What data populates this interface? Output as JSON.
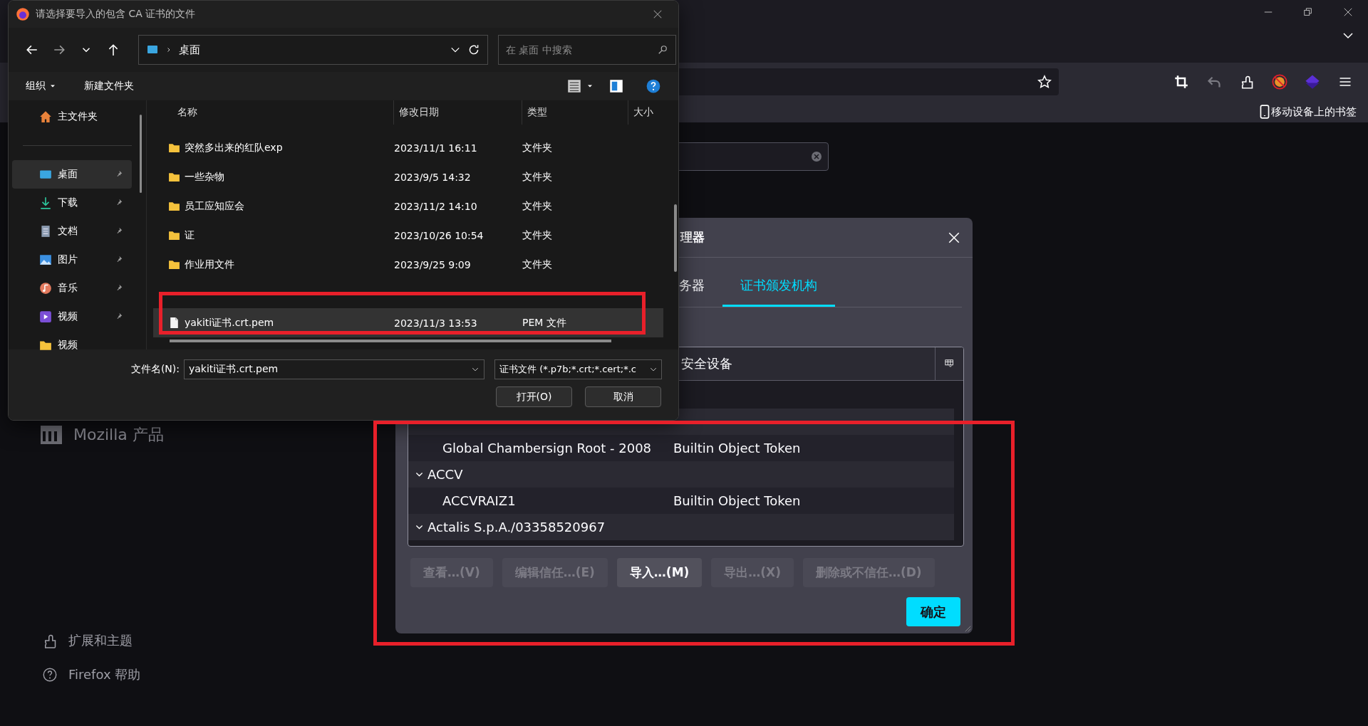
{
  "browser": {
    "bookmarks_bar": {
      "item": "移动设备上的书签"
    },
    "content_links": [
      {
        "kind": "mozilla",
        "label": "Mozilla 产品"
      },
      {
        "kind": "extensions",
        "label": "扩展和主题"
      },
      {
        "kind": "help",
        "label": "Firefox 帮助"
      }
    ]
  },
  "cert_manager": {
    "title": "理器",
    "tabs": [
      {
        "label": "务器",
        "selected": false
      },
      {
        "label": "证书颁发机构",
        "selected": true
      }
    ],
    "columns": [
      "安全设备"
    ],
    "rows": [
      {
        "kind": "obscured"
      },
      {
        "kind": "leaf",
        "name": "Global Chambersign Root - 2008",
        "device": "Builtin Object Token"
      },
      {
        "kind": "group",
        "name": "ACCV",
        "expanded": true
      },
      {
        "kind": "leaf",
        "name": "ACCVRAIZ1",
        "device": "Builtin Object Token"
      },
      {
        "kind": "group",
        "name": "Actalis S.p.A./03358520967",
        "expanded": true
      }
    ],
    "buttons": [
      {
        "label": "查看…(V)",
        "disabled": true
      },
      {
        "label": "编辑信任…(E)",
        "disabled": true
      },
      {
        "label": "导入…(M)",
        "disabled": false
      },
      {
        "label": "导出…(X)",
        "disabled": true
      },
      {
        "label": "删除或不信任…(D)",
        "disabled": true
      }
    ],
    "ok_button": "确定"
  },
  "file_dialog": {
    "title": "请选择要导入的包含 CA 证书的文件",
    "path": [
      "桌面"
    ],
    "search": {
      "placeholder": "在 桌面 中搜索"
    },
    "commands": [
      "组织",
      "新建文件夹"
    ],
    "nav": [
      {
        "kind": "home",
        "label": "主文件夹",
        "pinned": false,
        "selected": false
      },
      {
        "kind": "desktop",
        "label": "桌面",
        "pinned": true,
        "selected": true
      },
      {
        "kind": "downloads",
        "label": "下载",
        "pinned": true,
        "selected": false
      },
      {
        "kind": "documents",
        "label": "文档",
        "pinned": true,
        "selected": false
      },
      {
        "kind": "pictures",
        "label": "图片",
        "pinned": true,
        "selected": false
      },
      {
        "kind": "music",
        "label": "音乐",
        "pinned": true,
        "selected": false
      },
      {
        "kind": "videos",
        "label": "视频",
        "pinned": true,
        "selected": false
      },
      {
        "kind": "folder",
        "label": "视频",
        "pinned": false,
        "selected": false
      }
    ],
    "columns": [
      "名称",
      "修改日期",
      "类型",
      "大小"
    ],
    "files": [
      {
        "kind": "folder",
        "name": "突然多出来的红队exp",
        "modified": "2023/11/1 16:11",
        "type": "文件夹",
        "selected": false
      },
      {
        "kind": "folder",
        "name": "一些杂物",
        "modified": "2023/9/5 14:32",
        "type": "文件夹",
        "selected": false
      },
      {
        "kind": "folder",
        "name": "员工应知应会",
        "modified": "2023/11/2 14:10",
        "type": "文件夹",
        "selected": false
      },
      {
        "kind": "folder",
        "name": "证",
        "modified": "2023/10/26 10:54",
        "type": "文件夹",
        "selected": false
      },
      {
        "kind": "folder",
        "name": "作业用文件",
        "modified": "2023/9/25 9:09",
        "type": "文件夹",
        "selected": false
      },
      {
        "kind": "obscured"
      },
      {
        "kind": "file",
        "name": "yakiti证书.crt.pem",
        "modified": "2023/11/3 13:53",
        "type": "PEM 文件",
        "selected": true
      }
    ],
    "file_name": {
      "label": "文件名(N):",
      "value": "yakiti证书.crt.pem"
    },
    "filter": "证书文件 (*.p7b;*.crt;*.cert;*.c",
    "buttons": [
      "打开(O)",
      "取消"
    ]
  }
}
